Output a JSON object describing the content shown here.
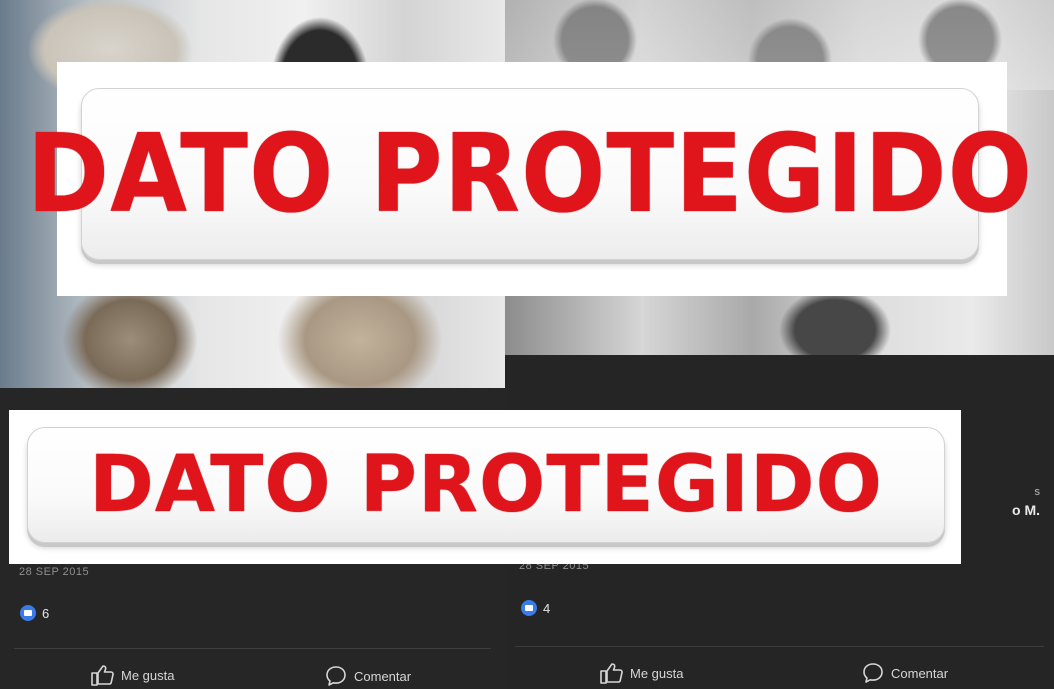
{
  "redactions": {
    "top_label": "DATO PROTEGIDO",
    "bottom_label": "DATO PROTEGIDO",
    "text_color": "#e0141b"
  },
  "posts": [
    {
      "date": "28 SEP 2015",
      "reaction_count": "6",
      "actions": {
        "like": "Me gusta",
        "comment": "Comentar"
      }
    },
    {
      "name_fragment_line1": "s",
      "name_fragment_line2": "o M.",
      "date": "28 SEP 2015",
      "reaction_count": "4",
      "actions": {
        "like": "Me gusta",
        "comment": "Comentar"
      }
    }
  ],
  "colors": {
    "background": "#262626",
    "like_badge": "#3b7be8"
  },
  "icons": {
    "like": "thumbs-up-icon",
    "comment": "speech-bubble-icon",
    "reaction": "like-reaction-icon"
  }
}
